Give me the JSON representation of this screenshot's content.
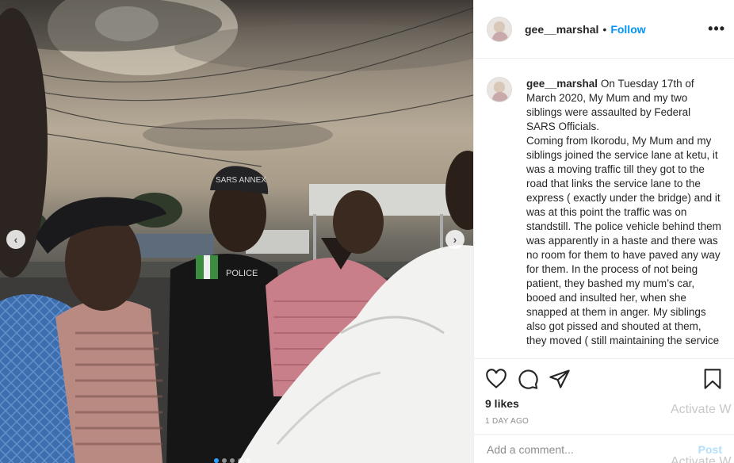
{
  "post": {
    "username": "gee__marshal",
    "separator": "•",
    "follow_label": "Follow",
    "more_label": "•••"
  },
  "photo": {
    "prev_label": "‹",
    "next_label": "›",
    "cap_text": "SARS ANNEX",
    "vest_text": "POLICE"
  },
  "caption": {
    "username": "gee__marshal",
    "paragraph1": "On Tuesday 17th of March 2020, My Mum and my two siblings were assaulted by Federal SARS Officials.",
    "paragraph2": "Coming from Ikorodu, My Mum and my siblings joined the service lane at ketu, it was a moving traffic till they got to the road that links the service lane to the express ( exactly under the bridge) and it was at this point the traffic was on standstill. The police vehicle behind them was apparently in a haste and there was no room for them to have paved any way for them. In the process of not being patient, they bashed my mum’s car, booed and insulted her, when she snapped at them in anger. My siblings also got pissed and shouted at them, they moved ( still maintaining the service"
  },
  "actions": {
    "like_icon": "heart-icon",
    "comment_icon": "comment-icon",
    "share_icon": "share-icon",
    "save_icon": "bookmark-icon",
    "likes": "9 likes",
    "timestamp": "1 DAY AGO"
  },
  "comment_box": {
    "placeholder": "Add a comment...",
    "post_label": "Post"
  },
  "overlay": {
    "watermark_line1": "Activate W",
    "watermark_line2": "Activate W"
  },
  "colors": {
    "link": "#0095f6",
    "post_disabled": "#b2dffc",
    "dot_active": "#2ea1ff"
  }
}
